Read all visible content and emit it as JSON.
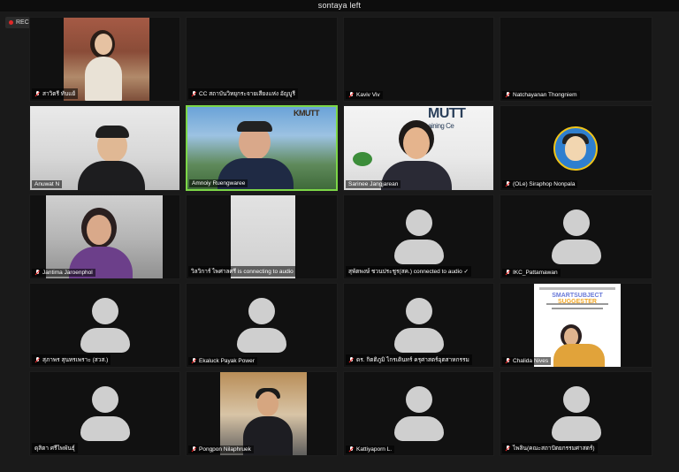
{
  "window": {
    "title": "sontaya left"
  },
  "recording": {
    "label": "REC"
  },
  "colors": {
    "active_speaker": "#7cd647",
    "muted": "#e22222",
    "recording": "#e02828"
  },
  "participants": [
    {
      "name": "สาวิตรี ทับแย้",
      "muted": true,
      "video": true
    },
    {
      "name": "CC สถาบันวิทยุกระจายเสียงแห่ง อัญบูรี",
      "muted": true,
      "video": false
    },
    {
      "name": "Kaviv Viv",
      "muted": true,
      "video": false
    },
    {
      "name": "Natchayanan Thongniem",
      "muted": true,
      "video": false
    },
    {
      "name": "Anuwat N",
      "muted": false,
      "video": true
    },
    {
      "name": "Amnoiy Ruengwaree",
      "muted": false,
      "video": true,
      "active": true
    },
    {
      "name": "Sarinee Jangjarean",
      "muted": false,
      "video": true
    },
    {
      "name": "(OLe) Siraphop Nonpala",
      "muted": true,
      "video": false
    },
    {
      "name": "Jantima Jaroenphol",
      "muted": true,
      "video": true
    },
    {
      "name": "วิลวิการ์ ไพศาลศรี is connecting to audio",
      "muted": false,
      "video": true
    },
    {
      "name": "สุพัตพงษ์ ชวนประชูร(สค.) connected to audio ✓",
      "muted": false,
      "video": false
    },
    {
      "name": "IKC_Pattamawan",
      "muted": true,
      "video": false
    },
    {
      "name": "สุภาพร สุนทรเพราะ (สวส.)",
      "muted": true,
      "video": false
    },
    {
      "name": "Ekaluck Payak Power",
      "muted": true,
      "video": false
    },
    {
      "name": "ดร. กิตติภูมิ ไกรเดินทร์ ครุศาสตร์อุตสาหกรรม",
      "muted": true,
      "video": false
    },
    {
      "name": "Chalida Nives",
      "muted": true,
      "video": true
    },
    {
      "name": "ดุสิตา ศรีไพพันธุ์",
      "muted": false,
      "video": false
    },
    {
      "name": "Pongpon Nilaphruek",
      "muted": true,
      "video": true
    },
    {
      "name": "Kattiyaporn L.",
      "muted": true,
      "video": false
    },
    {
      "name": "ไพลิน(คณะสถาปัตยกรรมศาสตร์)",
      "muted": true,
      "video": false
    }
  ],
  "tiles": {
    "kmutt_sign": {
      "main": "MUTT",
      "sub": "aining Ce"
    },
    "tile2_sign": "KMUTT",
    "poster": {
      "brand_a": "SMARTSUBJECT",
      "brand_b": "SUGGESTER"
    }
  }
}
